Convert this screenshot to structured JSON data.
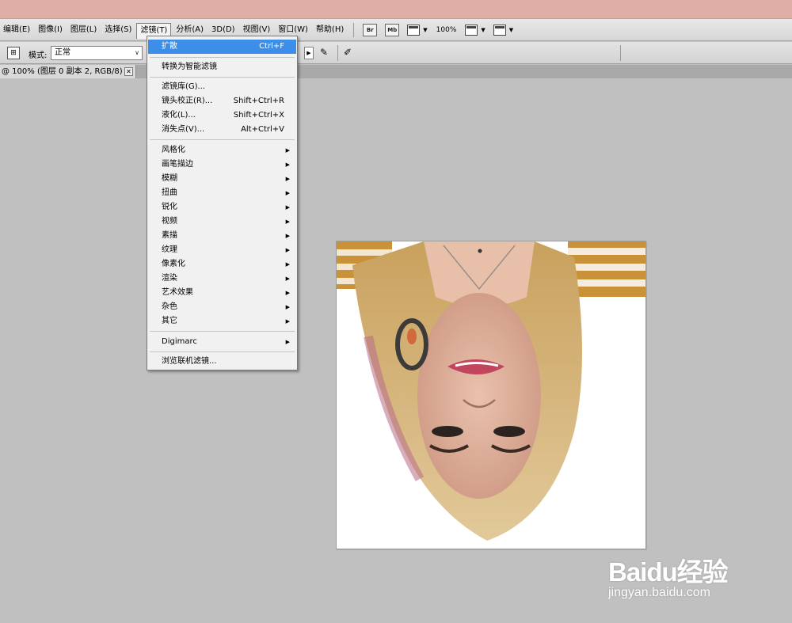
{
  "menubar": {
    "items": [
      "编辑(E)",
      "图像(I)",
      "图层(L)",
      "选择(S)",
      "滤镜(T)",
      "分析(A)",
      "3D(D)",
      "视图(V)",
      "窗口(W)",
      "帮助(H)"
    ],
    "active_index": 4,
    "bridge_label": "Br",
    "minibridge_label": "Mb",
    "zoom": "100%"
  },
  "options": {
    "mode_label": "模式:",
    "mode_value": "正常"
  },
  "document_tab": {
    "title": "@ 100% (图层 0 副本 2, RGB/8) *",
    "close": "✕"
  },
  "filter_menu": {
    "last_filter": {
      "label": "扩散",
      "shortcut": "Ctrl+F"
    },
    "smart": "转换为智能滤镜",
    "group1": [
      {
        "label": "滤镜库(G)...",
        "shortcut": ""
      },
      {
        "label": "镜头校正(R)...",
        "shortcut": "Shift+Ctrl+R"
      },
      {
        "label": "液化(L)...",
        "shortcut": "Shift+Ctrl+X"
      },
      {
        "label": "消失点(V)...",
        "shortcut": "Alt+Ctrl+V"
      }
    ],
    "submenus": [
      "风格化",
      "画笔描边",
      "模糊",
      "扭曲",
      "锐化",
      "视频",
      "素描",
      "纹理",
      "像素化",
      "渲染",
      "艺术效果",
      "杂色",
      "其它"
    ],
    "digimarc": "Digimarc",
    "browse": "浏览联机滤镜..."
  },
  "watermark": {
    "logo": "Baidu经验",
    "url": "jingyan.baidu.com"
  },
  "colors": {
    "titlebar": "#dfaea6",
    "workspace": "#c0c0c0",
    "menu_highlight": "#3d8ee8"
  }
}
